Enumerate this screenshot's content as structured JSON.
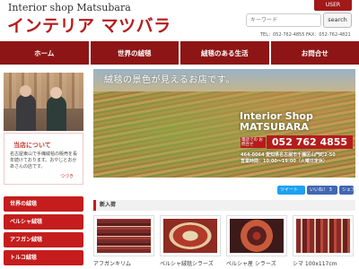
{
  "header": {
    "logo_small": "Interior shop Matsubara",
    "logo_main": "インテリア マツバラ",
    "user_label": "USER",
    "search_placeholder": "キーワード",
    "search_button": "search",
    "contact": "TEL：052-762-4855 FAX：052-762-4821"
  },
  "nav": {
    "items": [
      "ホーム",
      "世界の絨毯",
      "絨毯のある生活",
      "お問合せ"
    ]
  },
  "sidebar": {
    "shop_info_title": "当店について",
    "shop_info_text": "名古屋東山で手織絨毯の販売を長年続けております。おやじとおかあさんの店です。",
    "shop_info_more": "つづき",
    "menu": [
      "世界の絨毯",
      "ペルシャ絨毯",
      "アフガン絨毯",
      "トルコ絨毯"
    ]
  },
  "banner": {
    "slogan": "絨毯の景色が見えるお店です。",
    "title": "Interior Shop MATSUBARA",
    "phone_label": "電話での お問合せ",
    "phone": "052 762 4855",
    "address": "464-0064 愛知県名古屋市千種区山門町2-50",
    "hours": "営業時間：10:00～19:00（火曜日定休）"
  },
  "social": {
    "tweet": "ツイート",
    "like": "いいね！ 3",
    "share": "シェア"
  },
  "new_arrivals": {
    "title": "新入荷",
    "products": [
      {
        "name": "アフガンキリム"
      },
      {
        "name": "ペルシャ絨毯シラーズ"
      },
      {
        "name": "ペルシャ産 シラーズ"
      },
      {
        "name": "シマ 100x117cm"
      }
    ]
  },
  "colors": {
    "brand_red": "#b51c1c",
    "nav_bg": "#8e1515",
    "side_menu_red": "#c51d1d"
  }
}
